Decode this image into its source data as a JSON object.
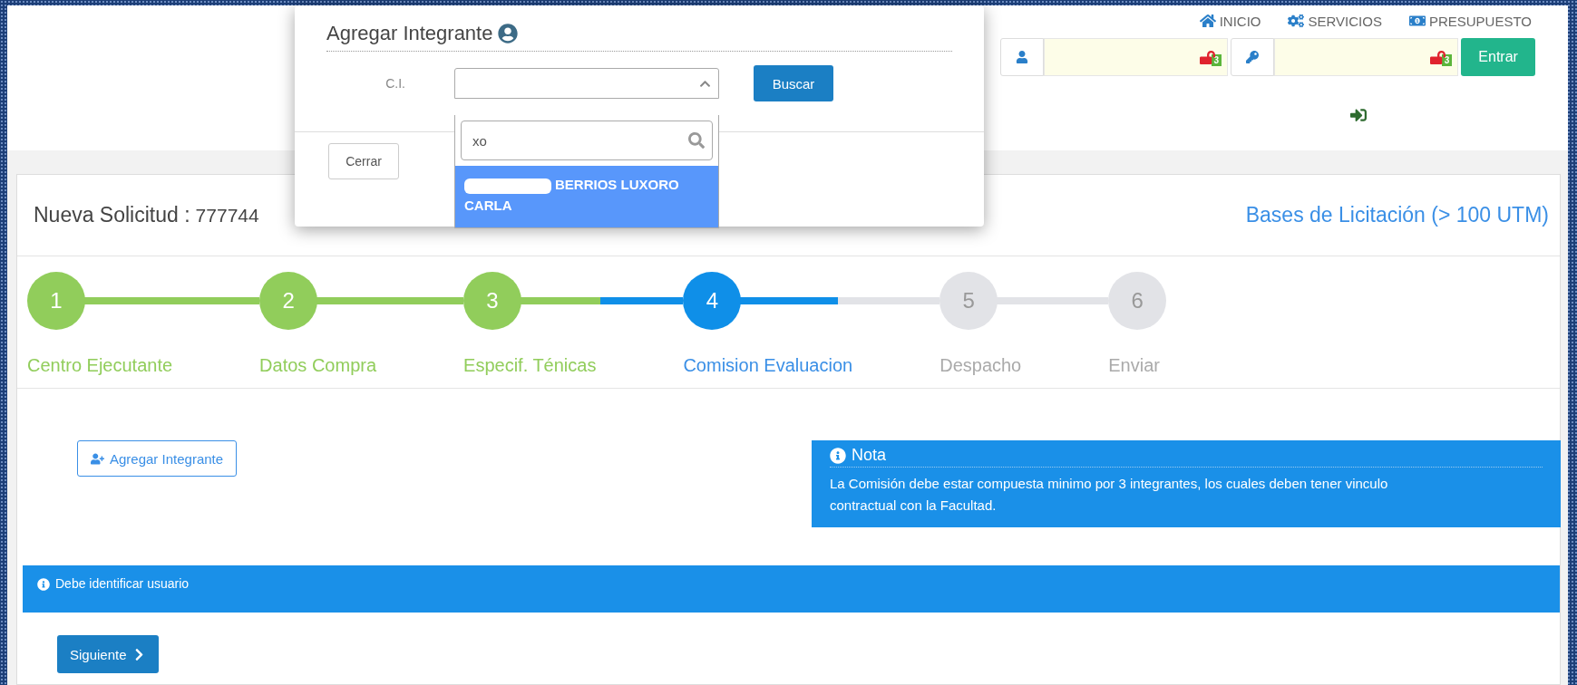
{
  "header": {
    "nav": [
      {
        "label": "INICIO"
      },
      {
        "label": "SERVICIOS"
      },
      {
        "label": "PRESUPUESTO"
      }
    ],
    "login": {
      "fields": [
        {
          "kind": "user",
          "badge": "3"
        },
        {
          "kind": "password",
          "badge": "3"
        }
      ],
      "submit": "Entrar"
    }
  },
  "request": {
    "title": "Nueva Solicitud :",
    "number": "777744",
    "type_link": "Bases de Licitación (> 100 UTM)"
  },
  "steps": [
    {
      "number": "1",
      "label": "Centro Ejecutante",
      "completed": true,
      "selected": false
    },
    {
      "number": "2",
      "label": "Datos Compra",
      "completed": true,
      "selected": false
    },
    {
      "number": "3",
      "label": "Especif. Ténicas",
      "completed": true,
      "selected": false
    },
    {
      "number": "4",
      "label": "Comision Evaluacion",
      "completed": false,
      "selected": true
    },
    {
      "number": "5",
      "label": "Despacho",
      "completed": false,
      "selected": false
    },
    {
      "number": "6",
      "label": "Enviar",
      "completed": false,
      "selected": false
    }
  ],
  "add_member_button": "Agregar Integrante",
  "note": {
    "title": "Nota",
    "text": "La Comisión debe estar compuesta minimo por 3 integrantes, los cuales deben tener vinculo contractual con la Facultad."
  },
  "alert": "Debe identificar usuario",
  "next_button": "Siguiente",
  "modal": {
    "title": "Agregar Integrante",
    "ci_label": "C.I.",
    "search_button": "Buscar",
    "close_button": "Cerrar",
    "dropdown": {
      "expanded": true,
      "search_value": "xo",
      "options": [
        {
          "label": "BERRIOS LUXORO CARLA",
          "selected": true
        }
      ]
    }
  }
}
